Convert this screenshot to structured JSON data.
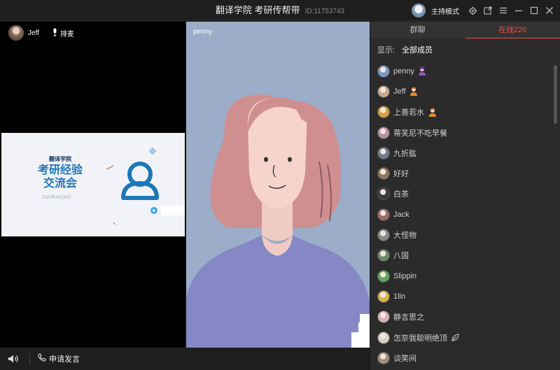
{
  "window": {
    "title": "翻译学院 考研传帮带",
    "room_id": "ID:11753743",
    "host_mode_label": "主持模式",
    "icons": [
      "settings-icon",
      "popout-icon",
      "menu-icon",
      "minimize-icon",
      "maximize-icon",
      "close-icon"
    ]
  },
  "left_video": {
    "user_name": "Jeff",
    "mic_label": "排麦",
    "slide": {
      "brand": "翻译学院",
      "title_line1": "考研经验",
      "title_line2": "交流会",
      "date": "2020年4月29日"
    }
  },
  "mid_video": {
    "user_name": "penny"
  },
  "bottom_bar": {
    "apply_label": "申请发言"
  },
  "chat_panel": {
    "tabs": [
      "群聊",
      "在线220"
    ],
    "active_tab": 1,
    "filter_label": "显示:",
    "filter_value": "全部成员",
    "members": [
      {
        "name": "penny",
        "badge": "teacher",
        "avatar_color": "#7b97c4"
      },
      {
        "name": "Jeff",
        "badge": "host",
        "avatar_color": "#c9a88f"
      },
      {
        "name": "上善若水",
        "badge": "host",
        "avatar_color": "#d4a23a"
      },
      {
        "name": "蒂芙尼不吃早餐",
        "badge": "",
        "avatar_color": "#b98fa3"
      },
      {
        "name": "九折肱",
        "badge": "",
        "avatar_color": "#6e7f8f"
      },
      {
        "name": "好好",
        "badge": "",
        "avatar_color": "#8c7a5a"
      },
      {
        "name": "白茶",
        "badge": "",
        "avatar_color": "#3a3a3a"
      },
      {
        "name": "Jack",
        "badge": "",
        "avatar_color": "#9a6b6b"
      },
      {
        "name": "大怪物",
        "badge": "",
        "avatar_color": "#8a8a8a"
      },
      {
        "name": "八国",
        "badge": "",
        "avatar_color": "#6a8a6a"
      },
      {
        "name": "Slippin",
        "badge": "",
        "avatar_color": "#5ea65e"
      },
      {
        "name": "1lin",
        "badge": "",
        "avatar_color": "#d8b04a"
      },
      {
        "name": "静言思之",
        "badge": "",
        "avatar_color": "#d9b0b8"
      },
      {
        "name": "怎奈我聪明绝顶",
        "badge": "leaf",
        "avatar_color": "#d8d0c0"
      },
      {
        "name": "谈笑间",
        "badge": "",
        "avatar_color": "#a09080"
      }
    ]
  }
}
